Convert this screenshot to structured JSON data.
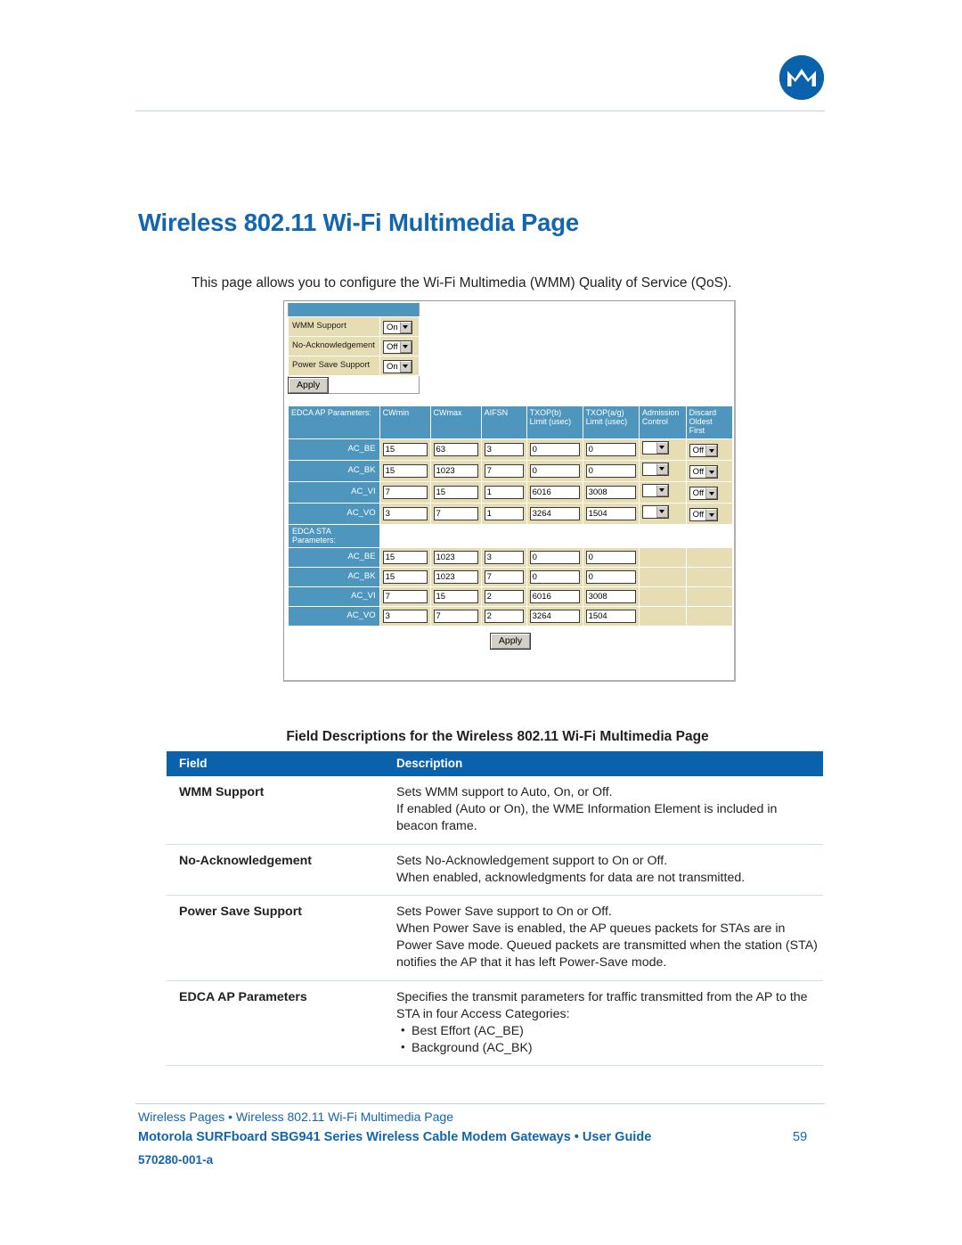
{
  "header": {
    "logo_alt": "Motorola batwing logo",
    "brand_color": "#0a62ad"
  },
  "page_title": "Wireless 802.11 Wi-Fi Multimedia Page",
  "intro": "This page allows you to configure the Wi-Fi Multimedia (WMM) Quality of Service (QoS).",
  "figure": {
    "wmm": {
      "rows": [
        {
          "label": "WMM Support",
          "value": "On"
        },
        {
          "label": "No-Acknowledgement",
          "value": "Off"
        },
        {
          "label": "Power Save Support",
          "value": "On"
        }
      ],
      "apply_label": "Apply"
    },
    "edca": {
      "ap_header_label": "EDCA AP Parameters:",
      "sta_header_label": "EDCA STA Parameters:",
      "columns": [
        "CWmin",
        "CWmax",
        "AIFSN",
        "TXOP(b)\nLimit (usec)",
        "TXOP(a/g)\nLimit (usec)",
        "Admission\nControl",
        "Discard\nOldest First"
      ],
      "columns_split": [
        {
          "line1": "CWmin",
          "line2": ""
        },
        {
          "line1": "CWmax",
          "line2": ""
        },
        {
          "line1": "AIFSN",
          "line2": ""
        },
        {
          "line1": "TXOP(b)",
          "line2": "Limit (usec)"
        },
        {
          "line1": "TXOP(a/g)",
          "line2": "Limit (usec)"
        },
        {
          "line1": "Admission",
          "line2": "Control"
        },
        {
          "line1": "Discard",
          "line2": "Oldest First"
        }
      ],
      "ap_rows": [
        {
          "ac": "AC_BE",
          "cwmin": "15",
          "cwmax": "63",
          "aifsn": "3",
          "txop_b": "0",
          "txop_ag": "0",
          "admission": "",
          "discard": "Off"
        },
        {
          "ac": "AC_BK",
          "cwmin": "15",
          "cwmax": "1023",
          "aifsn": "7",
          "txop_b": "0",
          "txop_ag": "0",
          "admission": "",
          "discard": "Off"
        },
        {
          "ac": "AC_VI",
          "cwmin": "7",
          "cwmax": "15",
          "aifsn": "1",
          "txop_b": "6016",
          "txop_ag": "3008",
          "admission": "",
          "discard": "Off"
        },
        {
          "ac": "AC_VO",
          "cwmin": "3",
          "cwmax": "7",
          "aifsn": "1",
          "txop_b": "3264",
          "txop_ag": "1504",
          "admission": "",
          "discard": "Off"
        }
      ],
      "sta_rows": [
        {
          "ac": "AC_BE",
          "cwmin": "15",
          "cwmax": "1023",
          "aifsn": "3",
          "txop_b": "0",
          "txop_ag": "0"
        },
        {
          "ac": "AC_BK",
          "cwmin": "15",
          "cwmax": "1023",
          "aifsn": "7",
          "txop_b": "0",
          "txop_ag": "0"
        },
        {
          "ac": "AC_VI",
          "cwmin": "7",
          "cwmax": "15",
          "aifsn": "2",
          "txop_b": "6016",
          "txop_ag": "3008"
        },
        {
          "ac": "AC_VO",
          "cwmin": "3",
          "cwmax": "7",
          "aifsn": "2",
          "txop_b": "3264",
          "txop_ag": "1504"
        }
      ],
      "apply_label": "Apply"
    }
  },
  "field_descriptions": {
    "title": "Field Descriptions for the Wireless 802.11 Wi-Fi Multimedia Page",
    "col_field": "Field",
    "col_description": "Description",
    "rows": [
      {
        "field": "WMM Support",
        "lines": [
          "Sets WMM support to Auto, On, or Off.",
          "If enabled (Auto or On), the WME Information Element is included in beacon frame."
        ],
        "bullets": []
      },
      {
        "field": "No-Acknowledgement",
        "lines": [
          "Sets No-Acknowledgement support to On or Off.",
          "When enabled, acknowledgments for data are not transmitted."
        ],
        "bullets": []
      },
      {
        "field": "Power Save Support",
        "lines": [
          "Sets Power Save support to On or Off.",
          "When Power Save is enabled, the AP queues packets for STAs are in Power Save mode. Queued packets are transmitted when the station (STA) notifies the AP that it has left Power-Save mode."
        ],
        "bullets": []
      },
      {
        "field": "EDCA AP Parameters",
        "lines": [
          "Specifies the transmit parameters for traffic transmitted from the AP to the STA in four Access Categories:"
        ],
        "bullets": [
          "Best Effort (AC_BE)",
          "Background (AC_BK)"
        ]
      }
    ]
  },
  "footer": {
    "breadcrumb": "Wireless Pages • Wireless 802.11 Wi-Fi Multimedia Page",
    "title": "Motorola SURFboard SBG941 Series Wireless Cable Modem Gateways • User Guide",
    "page_number": "59",
    "doc_number": "570280-001-a"
  }
}
